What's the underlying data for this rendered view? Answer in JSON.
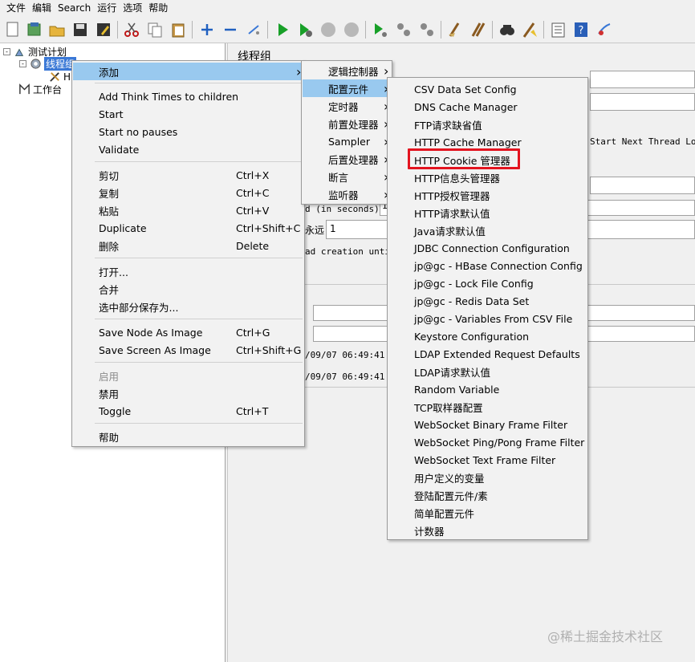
{
  "menubar": {
    "items": [
      "文件",
      "编辑",
      "Search",
      "运行",
      "选项",
      "帮助"
    ]
  },
  "toolbar": {
    "icons": [
      "new-icon",
      "templates-icon",
      "open-icon",
      "save-icon",
      "save-as-icon",
      "cut-icon",
      "copy-icon",
      "paste-icon",
      "expand-icon",
      "collapse-icon",
      "toggle-icon",
      "start-icon",
      "start-no-pauses-icon",
      "stop-icon",
      "shutdown-icon",
      "remote-start-icon",
      "remote-stop-icon",
      "remote-shutdown-icon",
      "clear-icon",
      "clear-all-icon",
      "search-icon",
      "reset-search-icon",
      "function-helper-icon",
      "help-icon",
      "logger-icon"
    ]
  },
  "tree": {
    "root": "测试计划",
    "thread_group": "线程组",
    "child_fragment": "H",
    "workbench": "工作台"
  },
  "right_panel": {
    "title": "线程组",
    "start_next_loop": "Start Next Thread Loop",
    "ramp_label": "d (in seconds):",
    "ramp_value": "1",
    "loop_label": "永远",
    "loop_value": "1",
    "delay_label": "ad creation until",
    "time1": "/09/07 06:49:41",
    "time2": "/09/07 06:49:41"
  },
  "context_menu": {
    "items": [
      {
        "label": "添加",
        "shortcut": "",
        "submenu": true,
        "highlight": true,
        "disabled": false
      },
      {
        "label": "Add Think Times to children",
        "shortcut": ""
      },
      {
        "label": "Start",
        "shortcut": ""
      },
      {
        "label": "Start no pauses",
        "shortcut": ""
      },
      {
        "label": "Validate",
        "shortcut": ""
      },
      {
        "label": "剪切",
        "shortcut": "Ctrl+X"
      },
      {
        "label": "复制",
        "shortcut": "Ctrl+C"
      },
      {
        "label": "粘贴",
        "shortcut": "Ctrl+V"
      },
      {
        "label": "Duplicate",
        "shortcut": "Ctrl+Shift+C"
      },
      {
        "label": "删除",
        "shortcut": "Delete"
      },
      {
        "label": "打开...",
        "shortcut": ""
      },
      {
        "label": "合并",
        "shortcut": ""
      },
      {
        "label": "选中部分保存为...",
        "shortcut": ""
      },
      {
        "label": "Save Node As Image",
        "shortcut": "Ctrl+G"
      },
      {
        "label": "Save Screen As Image",
        "shortcut": "Ctrl+Shift+G"
      },
      {
        "label": "启用",
        "shortcut": "",
        "disabled": true
      },
      {
        "label": "禁用",
        "shortcut": ""
      },
      {
        "label": "Toggle",
        "shortcut": "Ctrl+T"
      },
      {
        "label": "帮助",
        "shortcut": ""
      }
    ]
  },
  "add_submenu": {
    "items": [
      {
        "label": "逻辑控制器",
        "highlight": false
      },
      {
        "label": "配置元件",
        "highlight": true
      },
      {
        "label": "定时器",
        "highlight": false
      },
      {
        "label": "前置处理器",
        "highlight": false
      },
      {
        "label": "Sampler",
        "highlight": false
      },
      {
        "label": "后置处理器",
        "highlight": false
      },
      {
        "label": "断言",
        "highlight": false
      },
      {
        "label": "监听器",
        "highlight": false
      }
    ]
  },
  "config_submenu": {
    "items": [
      "CSV Data Set Config",
      "DNS Cache Manager",
      "FTP请求缺省值",
      "HTTP Cache Manager",
      "HTTP Cookie 管理器",
      "HTTP信息头管理器",
      "HTTP授权管理器",
      "HTTP请求默认值",
      "Java请求默认值",
      "JDBC Connection Configuration",
      "jp@gc - HBase Connection Config",
      "jp@gc - Lock File Config",
      "jp@gc - Redis Data Set",
      "jp@gc - Variables From CSV File",
      "Keystore Configuration",
      "LDAP Extended Request Defaults",
      "LDAP请求默认值",
      "Random Variable",
      "TCP取样器配置",
      "WebSocket Binary Frame Filter",
      "WebSocket Ping/Pong Frame Filter",
      "WebSocket Text Frame Filter",
      "用户定义的变量",
      "登陆配置元件/素",
      "简单配置元件",
      "计数器"
    ]
  },
  "colors": {
    "highlight": "#99c9ef",
    "selection": "#3a78d6",
    "annotation": "#e3141f"
  },
  "watermark": "@稀土掘金技术社区"
}
